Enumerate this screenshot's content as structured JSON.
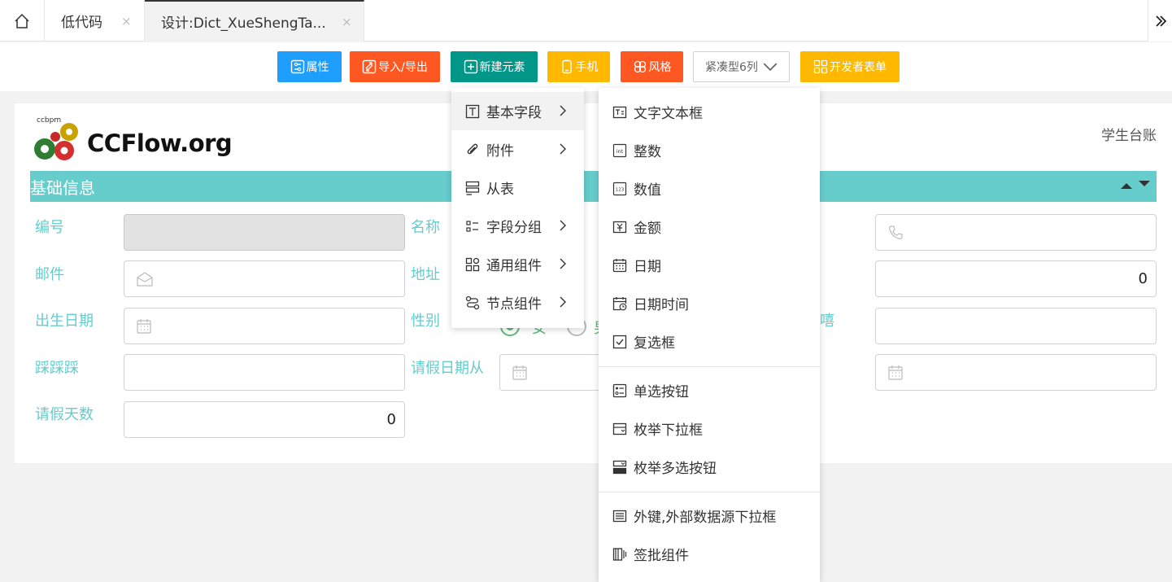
{
  "tabs": [
    {
      "label": "低代码",
      "close": "×"
    },
    {
      "label": "设计:Dict_XueShengTa...",
      "close": "×"
    }
  ],
  "toolbar": {
    "attr_label": "属性",
    "import_export_label": "导入/导出",
    "new_element_label": "新建元素",
    "mobile_label": "手机",
    "style_label": "风格",
    "layout_select_value": "紧凑型6列",
    "dev_form_label": "开发者表单"
  },
  "form": {
    "logo_small": "ccbpm",
    "logo_text": "CCFlow.org",
    "title": "学生台账",
    "group_title": "基础信息",
    "fields": {
      "bianhao": "编号",
      "mingcheng": "名称",
      "youjian": "邮件",
      "dizhi": "地址",
      "chusheng": "出生日期",
      "xingbie": "性别",
      "xixi": "嘻",
      "caicai": "踩踩踩",
      "qingjia_from": "请假日期从",
      "qingjia_days": "请假天数"
    },
    "values": {
      "right_col_number": "0",
      "qingjia_days": "0"
    },
    "radio_labels": [
      "女",
      "男"
    ]
  },
  "menu_level1": [
    {
      "icon": "text-field-icon",
      "label": "基本字段"
    },
    {
      "icon": "paperclip-icon",
      "label": "附件"
    },
    {
      "icon": "subtable-icon",
      "label": "从表"
    },
    {
      "icon": "field-group-icon",
      "label": "字段分组"
    },
    {
      "icon": "components-icon",
      "label": "通用组件"
    },
    {
      "icon": "node-component-icon",
      "label": "节点组件"
    }
  ],
  "menu_level2": [
    {
      "icon": "textbox-icon",
      "label": "文字文本框"
    },
    {
      "icon": "int-icon",
      "label": "整数"
    },
    {
      "icon": "decimal-icon",
      "label": "数值"
    },
    {
      "icon": "money-icon",
      "label": "金额"
    },
    {
      "icon": "calendar-icon",
      "label": "日期"
    },
    {
      "icon": "datetime-icon",
      "label": "日期时间"
    },
    {
      "icon": "checkbox-icon",
      "label": "复选框"
    },
    {
      "icon": "radio-list-icon",
      "label": "单选按钮"
    },
    {
      "icon": "dropdown-icon",
      "label": "枚举下拉框"
    },
    {
      "icon": "multi-select-icon",
      "label": "枚举多选按钮"
    },
    {
      "icon": "foreign-key-icon",
      "label": "外键,外部数据源下拉框"
    },
    {
      "icon": "signature-icon",
      "label": "签批组件"
    }
  ],
  "colors": {
    "accent_teal": "#66cccc",
    "blue": "#1e9fff",
    "orange": "#ff5722",
    "green": "#009688",
    "yellow": "#ffb800"
  }
}
